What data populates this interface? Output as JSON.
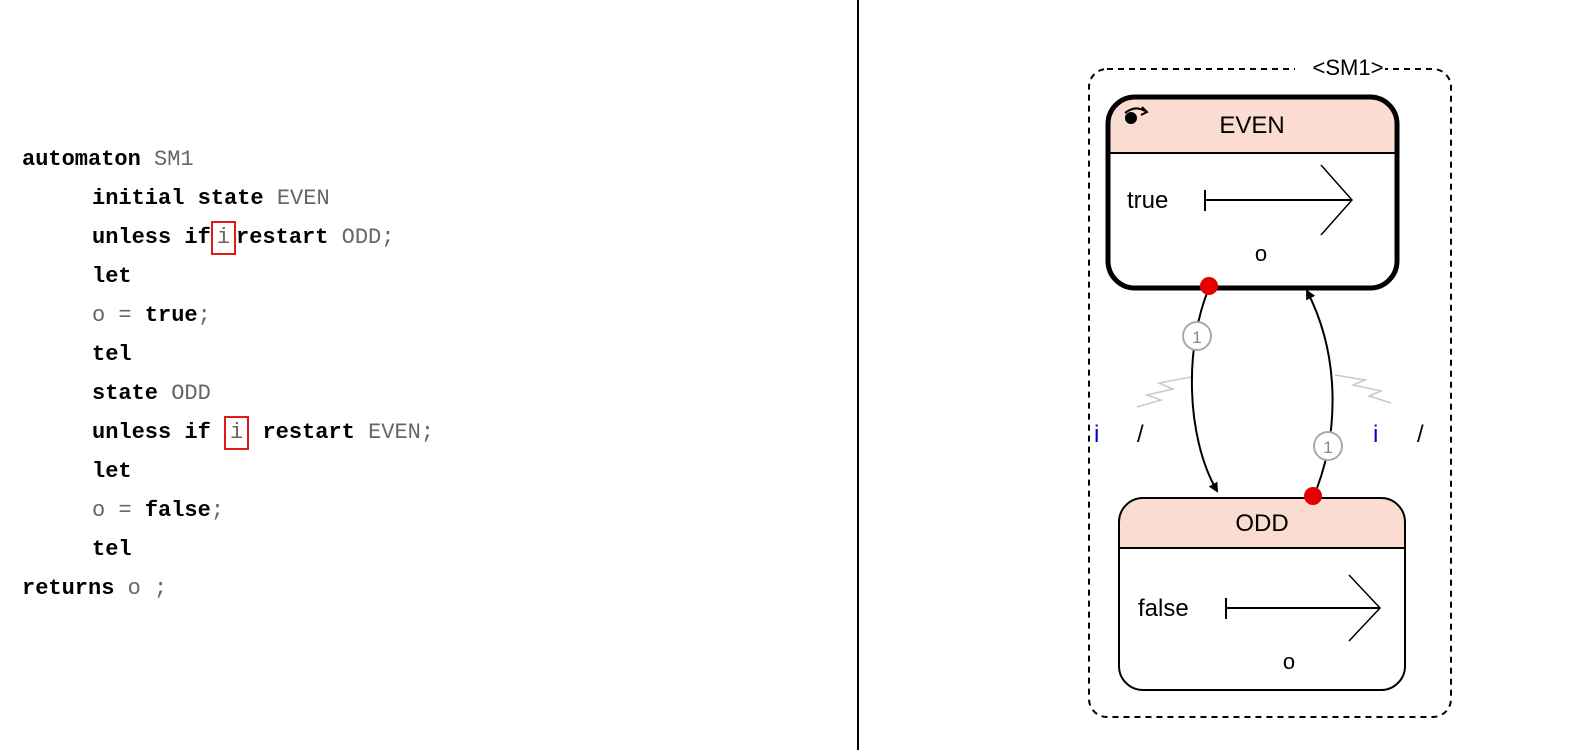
{
  "code": {
    "automaton_kw": "automaton",
    "automaton_name": "SM1",
    "initial_kw": "initial state",
    "state_even": "EVEN",
    "unless_kw_1": "unless if",
    "cond_1": "i",
    "restart_kw_1": "restart",
    "target_1": "ODD;",
    "let_1": "let",
    "assign_lhs_1": "o =",
    "value_1": "true",
    "semi_1": ";",
    "tel_1": "tel",
    "state_kw": "state",
    "state_odd": "ODD",
    "unless_kw_2": "unless if",
    "cond_2": "i",
    "restart_kw_2": "restart",
    "target_2": "EVEN;",
    "let_2": "let",
    "assign_lhs_2": "o =",
    "value_2": "false",
    "semi_2": ";",
    "tel_2": "tel",
    "returns_kw": "returns",
    "returns_val": "o ;"
  },
  "diagram": {
    "machine_label": "<SM1>",
    "even_state": {
      "name": "EVEN",
      "expr_label": "true",
      "output_label": "o",
      "initial_icon": "initial-state-marker-icon"
    },
    "odd_state": {
      "name": "ODD",
      "expr_label": "false",
      "output_label": "o"
    },
    "transition_left": {
      "priority": "1",
      "guard": "i",
      "slash": "/"
    },
    "transition_right": {
      "priority": "1",
      "guard": "i",
      "slash": "/"
    },
    "colors": {
      "state_header": "#fbdcd1",
      "transition_dot": "#e60000",
      "guard_text": "#0000cc",
      "highlight_box": "#e31818"
    }
  }
}
